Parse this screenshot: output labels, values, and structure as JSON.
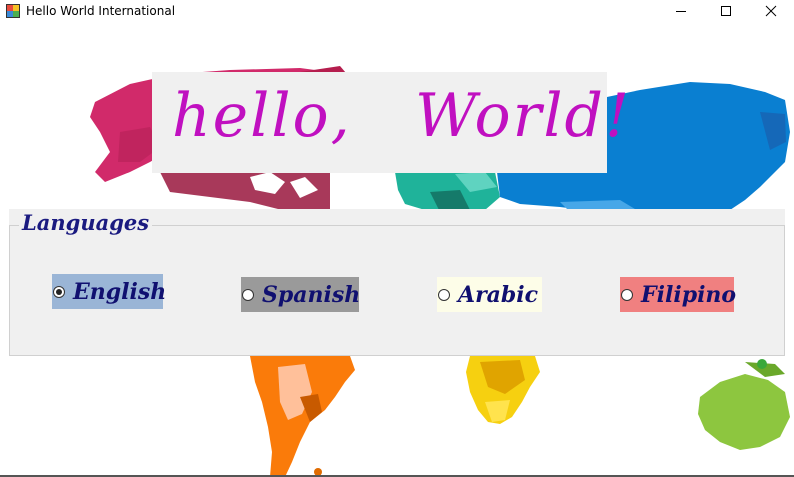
{
  "window": {
    "title": "Hello World International",
    "controls": [
      "minimize",
      "maximize",
      "close"
    ]
  },
  "greeting": {
    "text": "hello,   World!"
  },
  "languages": {
    "legend": "Languages",
    "options": [
      {
        "label": "English",
        "checked": true,
        "background": "#9ab5d6"
      },
      {
        "label": "Spanish",
        "checked": false,
        "background": "#9a9a9a"
      },
      {
        "label": "Arabic",
        "checked": false,
        "background": "#fdfde8"
      },
      {
        "label": "Filipino",
        "checked": false,
        "background": "#f08080"
      }
    ]
  },
  "colors": {
    "greeting_text": "#c010c0",
    "label_text": "#101070",
    "panel_background": "#f0f0f0"
  }
}
